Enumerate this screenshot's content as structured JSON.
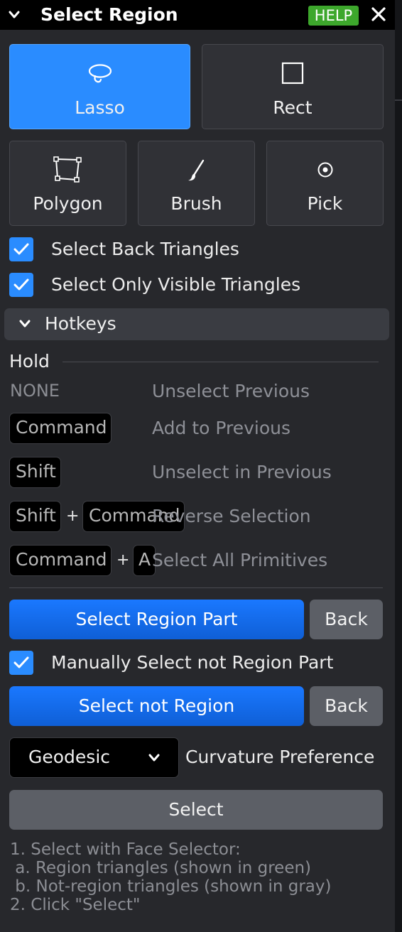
{
  "titlebar": {
    "title": "Select Region",
    "help_label": "HELP"
  },
  "tools": {
    "lasso": "Lasso",
    "rect": "Rect",
    "polygon": "Polygon",
    "brush": "Brush",
    "pick": "Pick",
    "active": "Lasso"
  },
  "options": {
    "back_triangles": {
      "label": "Select Back Triangles",
      "checked": true
    },
    "visible_triangles": {
      "label": "Select Only Visible Triangles",
      "checked": true
    }
  },
  "hotkeys": {
    "header": "Hotkeys",
    "hold_label": "Hold",
    "rows": [
      {
        "keys": [
          "NONE"
        ],
        "desc": "Unselect Previous"
      },
      {
        "keys": [
          "Command"
        ],
        "desc": "Add to Previous"
      },
      {
        "keys": [
          "Shift"
        ],
        "desc": "Unselect in Previous"
      },
      {
        "keys": [
          "Shift",
          "Command"
        ],
        "desc": "Reverse Selection"
      },
      {
        "keys": [
          "Command",
          "A"
        ],
        "desc": "Select All Primitives"
      }
    ],
    "plus": "+"
  },
  "actions": {
    "select_region_part": "Select Region Part",
    "back_1": "Back",
    "manual_label": "Manually Select not Region Part",
    "manual_checked": true,
    "select_not_region": "Select not Region",
    "back_2": "Back"
  },
  "curvature": {
    "value": "Geodesic",
    "label": "Curvature Preference"
  },
  "select_button": "Select",
  "instructions": [
    "1. Select with Face Selector:",
    " a. Region triangles (shown in green)",
    " b. Not-region triangles (shown in gray)",
    "2. Click \"Select\""
  ],
  "colors": {
    "accent": "#2a8cff",
    "help": "#3da72c",
    "panel": "#27282c"
  }
}
